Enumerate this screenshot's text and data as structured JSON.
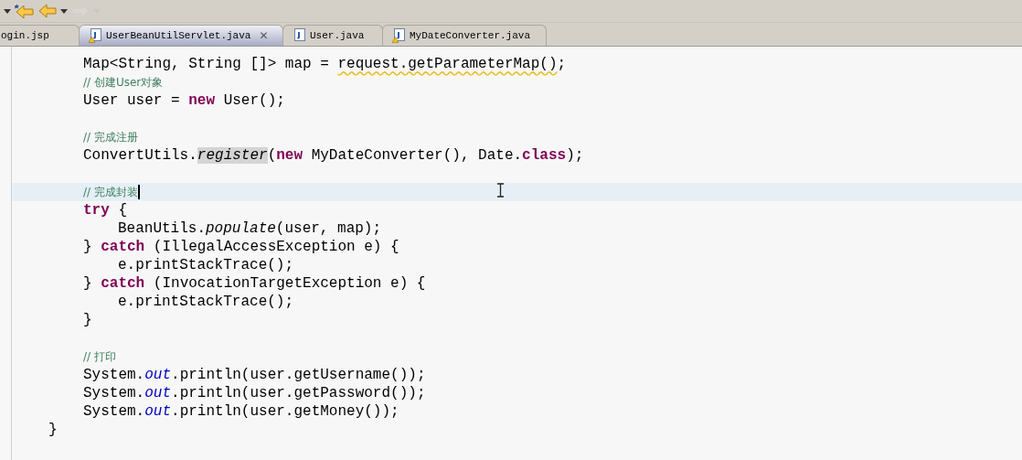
{
  "toolbar": {
    "buttons": [
      {
        "kind": "menu-arrow",
        "disabled": false
      },
      {
        "kind": "back-star",
        "disabled": false
      },
      {
        "kind": "back",
        "disabled": false
      },
      {
        "kind": "menu-arrow",
        "disabled": false
      },
      {
        "kind": "forward",
        "disabled": true
      },
      {
        "kind": "menu-arrow",
        "disabled": true
      }
    ]
  },
  "tabs": [
    {
      "label": "ogin.jsp",
      "selected": false,
      "kind": "cut-off"
    },
    {
      "label": "UserBeanUtilServlet.java",
      "selected": true,
      "kind": "java-file",
      "warning": true,
      "close": "✕"
    },
    {
      "label": "User.java",
      "selected": false,
      "kind": "java-file",
      "warning": false
    },
    {
      "label": "MyDateConverter.java",
      "selected": false,
      "kind": "java-file",
      "warning": true
    }
  ],
  "editor": {
    "lines": [
      {
        "kind": "body",
        "current": false,
        "tokens": [
          {
            "kind": "plain",
            "text": "Map<String, String []> map = "
          },
          {
            "kind": "warning",
            "text": "request.getParameterMap()"
          },
          {
            "kind": "plain",
            "text": ";"
          }
        ]
      },
      {
        "kind": "body",
        "current": false,
        "tokens": [
          {
            "kind": "comment",
            "text": "// 创建User对象"
          }
        ]
      },
      {
        "kind": "body",
        "current": false,
        "tokens": [
          {
            "kind": "plain",
            "text": "User user = "
          },
          {
            "kind": "keyword",
            "text": "new"
          },
          {
            "kind": "plain",
            "text": " User();"
          }
        ]
      },
      {
        "kind": "blank",
        "current": false
      },
      {
        "kind": "body",
        "current": false,
        "tokens": [
          {
            "kind": "comment",
            "text": "// 完成注册"
          }
        ]
      },
      {
        "kind": "body",
        "current": false,
        "tokens": [
          {
            "kind": "plain",
            "text": "ConvertUtils."
          },
          {
            "kind": "marked",
            "text": "register"
          },
          {
            "kind": "plain",
            "text": "("
          },
          {
            "kind": "keyword",
            "text": "new"
          },
          {
            "kind": "plain",
            "text": " MyDateConverter(), Date."
          },
          {
            "kind": "keyword",
            "text": "class"
          },
          {
            "kind": "plain",
            "text": ");"
          }
        ]
      },
      {
        "kind": "blank",
        "current": false
      },
      {
        "kind": "body",
        "current": true,
        "caret": true,
        "tokens": [
          {
            "kind": "comment",
            "text": "// 完成封装"
          }
        ]
      },
      {
        "kind": "body",
        "current": false,
        "tokens": [
          {
            "kind": "keyword",
            "text": "try"
          },
          {
            "kind": "plain",
            "text": " {"
          }
        ]
      },
      {
        "kind": "nested",
        "current": false,
        "tokens": [
          {
            "kind": "plain",
            "text": "BeanUtils."
          },
          {
            "kind": "static-method",
            "text": "populate"
          },
          {
            "kind": "plain",
            "text": "(user, map);"
          }
        ]
      },
      {
        "kind": "body",
        "current": false,
        "tokens": [
          {
            "kind": "plain",
            "text": "} "
          },
          {
            "kind": "keyword",
            "text": "catch"
          },
          {
            "kind": "plain",
            "text": " (IllegalAccessException e) {"
          }
        ]
      },
      {
        "kind": "nested",
        "current": false,
        "tokens": [
          {
            "kind": "plain",
            "text": "e.printStackTrace();"
          }
        ]
      },
      {
        "kind": "body",
        "current": false,
        "tokens": [
          {
            "kind": "plain",
            "text": "} "
          },
          {
            "kind": "keyword",
            "text": "catch"
          },
          {
            "kind": "plain",
            "text": " (InvocationTargetException e) {"
          }
        ]
      },
      {
        "kind": "nested",
        "current": false,
        "tokens": [
          {
            "kind": "plain",
            "text": "e.printStackTrace();"
          }
        ]
      },
      {
        "kind": "body",
        "current": false,
        "tokens": [
          {
            "kind": "plain",
            "text": "}"
          }
        ]
      },
      {
        "kind": "blank",
        "current": false
      },
      {
        "kind": "body",
        "current": false,
        "tokens": [
          {
            "kind": "comment",
            "text": "// 打印"
          }
        ]
      },
      {
        "kind": "body",
        "current": false,
        "tokens": [
          {
            "kind": "plain",
            "text": "System."
          },
          {
            "kind": "static-field",
            "text": "out"
          },
          {
            "kind": "plain",
            "text": ".println(user.getUsername());"
          }
        ]
      },
      {
        "kind": "body",
        "current": false,
        "tokens": [
          {
            "kind": "plain",
            "text": "System."
          },
          {
            "kind": "static-field",
            "text": "out"
          },
          {
            "kind": "plain",
            "text": ".println(user.getPassword());"
          }
        ]
      },
      {
        "kind": "body",
        "current": false,
        "tokens": [
          {
            "kind": "plain",
            "text": "System."
          },
          {
            "kind": "static-field",
            "text": "out"
          },
          {
            "kind": "plain",
            "text": ".println(user.getMoney());"
          }
        ]
      },
      {
        "kind": "method",
        "current": false,
        "tokens": [
          {
            "kind": "plain",
            "text": "}"
          }
        ]
      }
    ]
  }
}
